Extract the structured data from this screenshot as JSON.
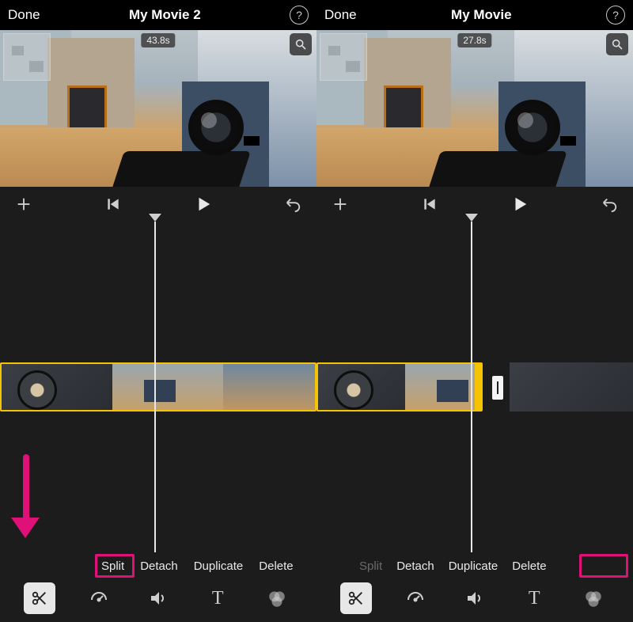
{
  "panels": [
    {
      "done": "Done",
      "title": "My Movie 2",
      "time": "43.8s",
      "actions": {
        "split": "Split",
        "detach": "Detach",
        "duplicate": "Duplicate",
        "delete": "Delete"
      }
    },
    {
      "done": "Done",
      "title": "My Movie",
      "time": "27.8s",
      "actions": {
        "split": "Split",
        "detach": "Detach",
        "duplicate": "Duplicate",
        "delete": "Delete"
      }
    }
  ],
  "icons": {
    "help": "?",
    "magnifier": "search",
    "add": "+",
    "skip_back": "skip-back",
    "play": "play",
    "undo": "undo",
    "scissors": "scissors",
    "speed": "speedometer",
    "volume": "volume",
    "text": "T",
    "filters": "filters"
  },
  "colors": {
    "highlight": "#e01079",
    "clip_border": "#f6c300"
  }
}
